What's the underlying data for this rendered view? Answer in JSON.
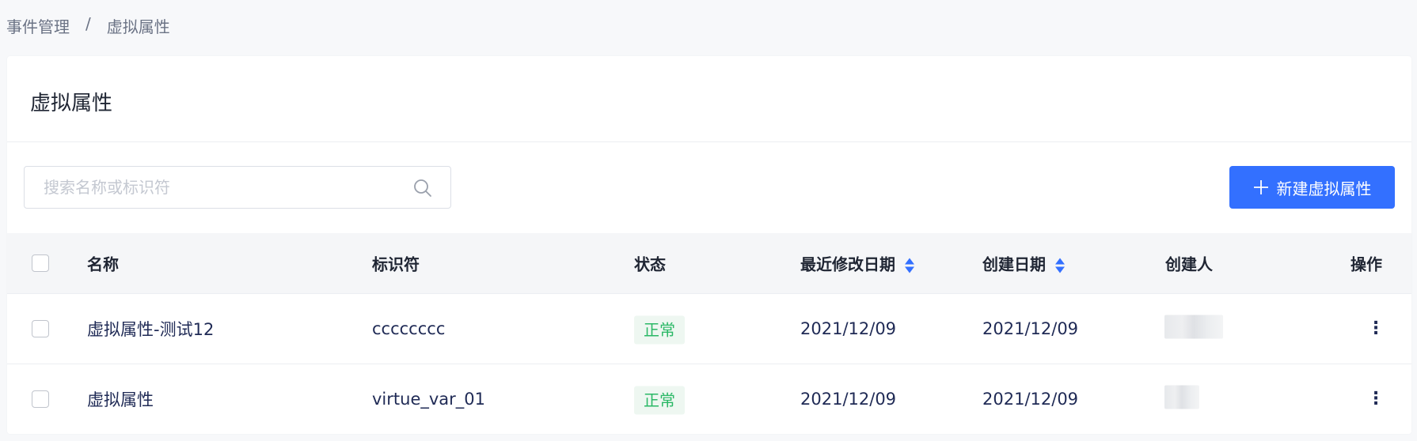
{
  "breadcrumb": {
    "parent": "事件管理",
    "separator": "/",
    "current": "虚拟属性"
  },
  "page": {
    "title": "虚拟属性"
  },
  "search": {
    "placeholder": "搜索名称或标识符",
    "value": ""
  },
  "toolbar": {
    "new_label": "新建虚拟属性",
    "new_icon": "plus-icon"
  },
  "table": {
    "headers": {
      "name": "名称",
      "identifier": "标识符",
      "status": "状态",
      "modified": "最近修改日期",
      "created": "创建日期",
      "creator": "创建人",
      "actions": "操作"
    },
    "rows": [
      {
        "name": "虚拟属性-测试12",
        "identifier": "cccccccc",
        "status": "正常",
        "modified": "2021/12/09",
        "created": "2021/12/09"
      },
      {
        "name": "虚拟属性",
        "identifier": "virtue_var_01",
        "status": "正常",
        "modified": "2021/12/09",
        "created": "2021/12/09"
      }
    ]
  },
  "colors": {
    "accent": "#3370ff",
    "status_ok": "#2bb866"
  }
}
